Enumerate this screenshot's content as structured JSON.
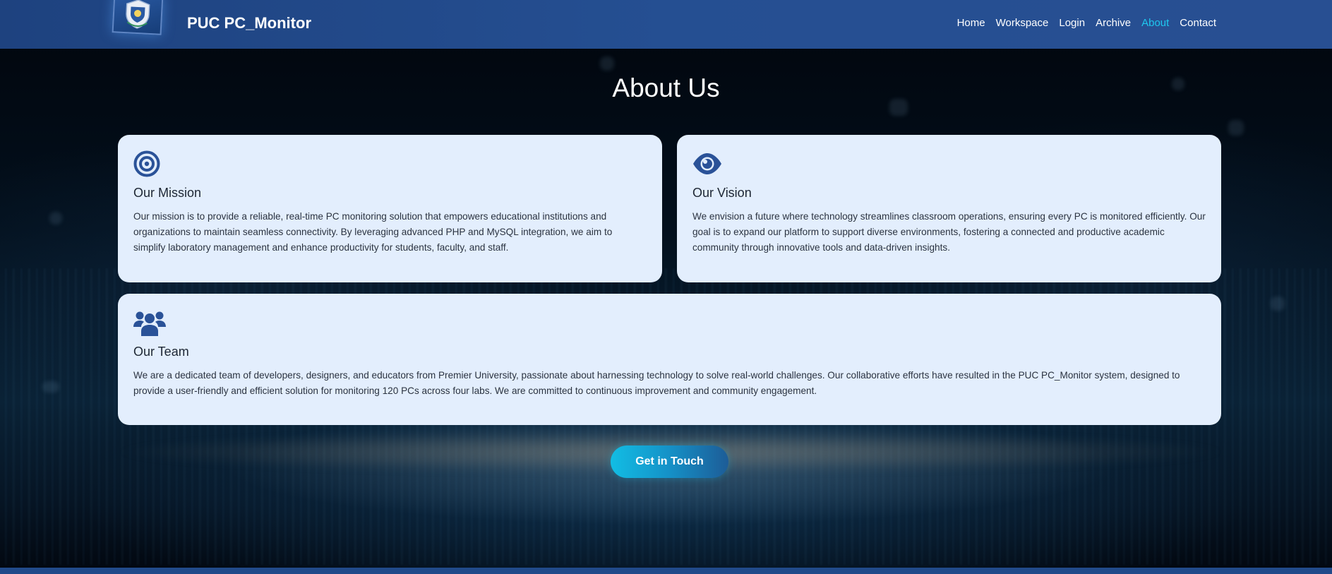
{
  "header": {
    "brand": "PUC PC_Monitor",
    "logo_icon": "university-crest-icon",
    "nav": [
      {
        "label": "Home",
        "active": false
      },
      {
        "label": "Workspace",
        "active": false
      },
      {
        "label": "Login",
        "active": false
      },
      {
        "label": "Archive",
        "active": false
      },
      {
        "label": "About",
        "active": true
      },
      {
        "label": "Contact",
        "active": false
      }
    ]
  },
  "main": {
    "title": "About Us",
    "cards": {
      "mission": {
        "icon": "bullseye-icon",
        "title": "Our Mission",
        "text": "Our mission is to provide a reliable, real-time PC monitoring solution that empowers educational institutions and organizations to maintain seamless connectivity. By leveraging advanced PHP and MySQL integration, we aim to simplify laboratory management and enhance productivity for students, faculty, and staff."
      },
      "vision": {
        "icon": "eye-icon",
        "title": "Our Vision",
        "text": "We envision a future where technology streamlines classroom operations, ensuring every PC is monitored efficiently. Our goal is to expand our platform to support diverse environments, fostering a connected and productive academic community through innovative tools and data-driven insights."
      },
      "team": {
        "icon": "users-icon",
        "title": "Our Team",
        "text": "We are a dedicated team of developers, designers, and educators from Premier University, passionate about harnessing technology to solve real-world challenges. Our collaborative efforts have resulted in the PUC PC_Monitor system, designed to provide a user-friendly and efficient solution for monitoring 120 PCs across four labs. We are committed to continuous improvement and community engagement."
      }
    },
    "cta_label": "Get in Touch"
  },
  "colors": {
    "header_bg": "#254f92",
    "active_nav": "#1ec8ef",
    "card_bg": "#e3eefd",
    "icon": "#2a5298",
    "cta_start": "#12bde4",
    "cta_end": "#1d5c97"
  }
}
